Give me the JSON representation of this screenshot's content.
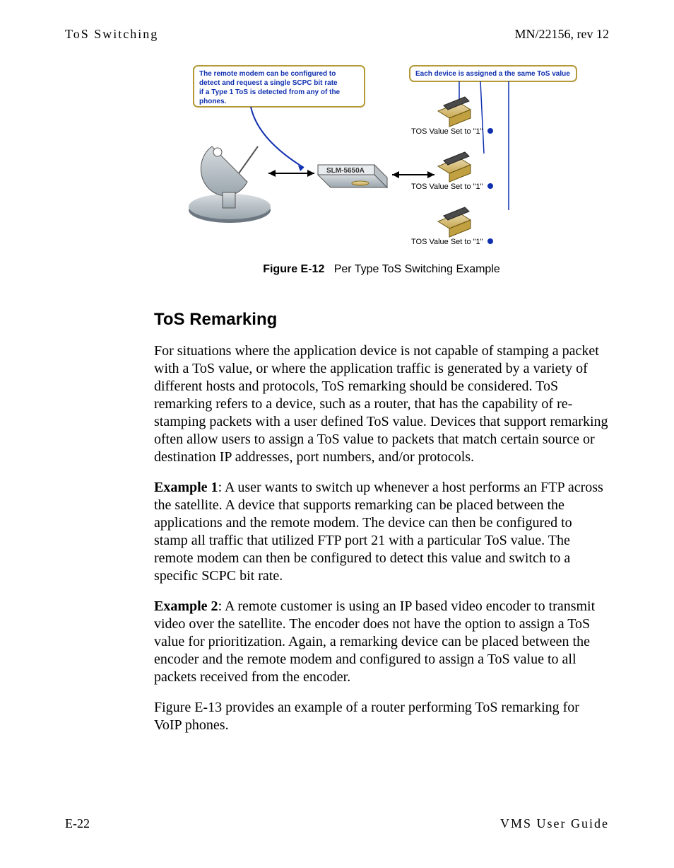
{
  "header": {
    "left": "ToS Switching",
    "right": "MN/22156, rev 12"
  },
  "figure": {
    "leftBox": {
      "l1": "The remote modem can be configured to",
      "l2": "detect and request a single SCPC bit rate",
      "l3": "if a Type 1 ToS is detected from any of the",
      "l4": "phones."
    },
    "rightBox": "Each device is assigned a the same ToS value",
    "modem": "SLM-5650A",
    "tosLabel": "TOS Value Set to \"1\""
  },
  "caption": {
    "label": "Figure E-12",
    "text": "Per Type ToS Switching Example"
  },
  "section": {
    "heading": "ToS Remarking",
    "p1": "For situations where the application device is not capable of stamping a packet with a ToS value, or where the application traffic is generated by a variety of different hosts and protocols, ToS remarking should be considered. ToS remarking refers to a device, such as a router, that has the capability of re-stamping packets with a user defined ToS value. Devices that support remarking often allow users to assign a ToS value to packets that match certain source or destination IP addresses, port numbers, and/or protocols.",
    "ex1": {
      "label": "Example 1",
      "text": ": A user wants to switch up whenever a host performs an FTP across the satellite. A device that supports remarking can be placed between the applications and the remote modem. The device can then be configured to stamp all traffic that utilized FTP port 21 with a particular ToS value. The remote modem can then be configured to detect this value and switch to a specific SCPC bit rate."
    },
    "ex2": {
      "label": "Example 2",
      "text": ": A remote customer is using an IP based video encoder to transmit video over the satellite. The encoder does not have the option to assign a ToS value for prioritization. Again, a remarking device can be placed between the encoder and the remote modem and configured to assign a ToS value to all packets received from the encoder."
    },
    "p4": "Figure E-13 provides an example of a router performing ToS remarking for VoIP phones."
  },
  "footer": {
    "left": "E-22",
    "right": "VMS User Guide"
  }
}
